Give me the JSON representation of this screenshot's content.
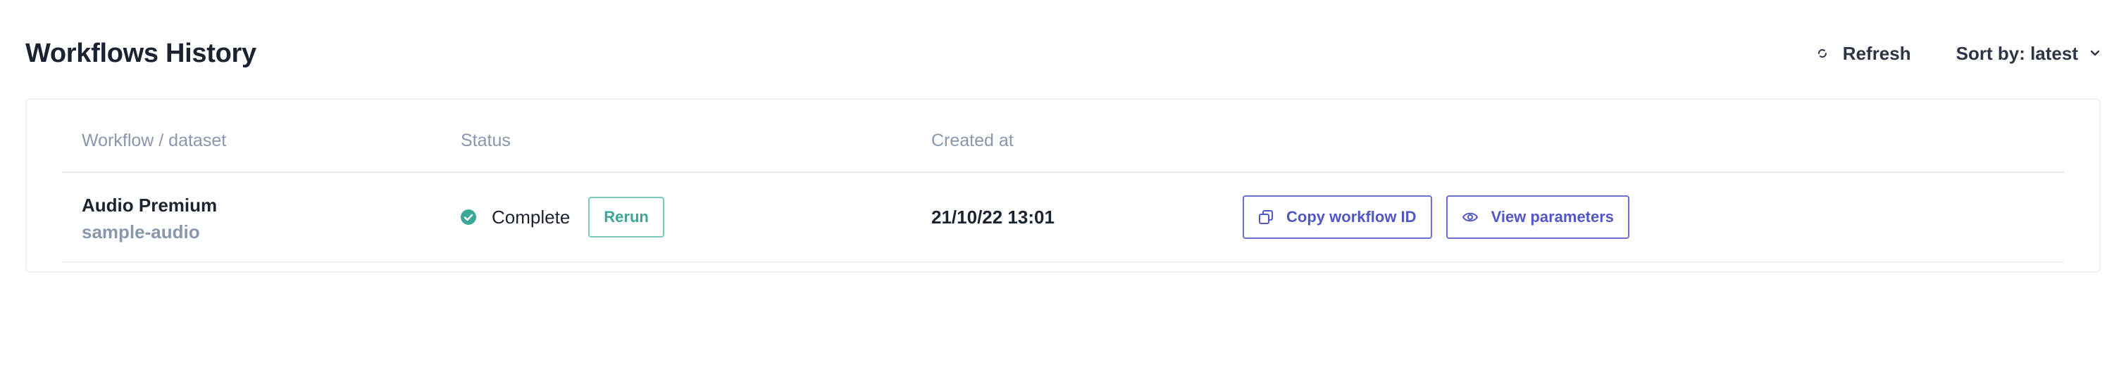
{
  "header": {
    "title": "Workflows History",
    "refresh_label": "Refresh",
    "sort_label": "Sort by: latest"
  },
  "table": {
    "columns": [
      "Workflow / dataset",
      "Status",
      "Created at"
    ],
    "rows": [
      {
        "workflow": "Audio Premium",
        "dataset": "sample-audio",
        "status": "Complete",
        "rerun_label": "Rerun",
        "created_at": "21/10/22 13:01",
        "copy_label": "Copy workflow ID",
        "view_label": "View parameters"
      }
    ]
  },
  "icons": {
    "refresh": "refresh-icon",
    "sort": "chevron-down-icon",
    "status": "check-circle-icon",
    "copy": "copy-icon",
    "view": "eye-icon"
  },
  "colors": {
    "title": "#1b2230",
    "muted": "#8a96ab",
    "success": "#3aa896",
    "accent": "#5157c9"
  }
}
